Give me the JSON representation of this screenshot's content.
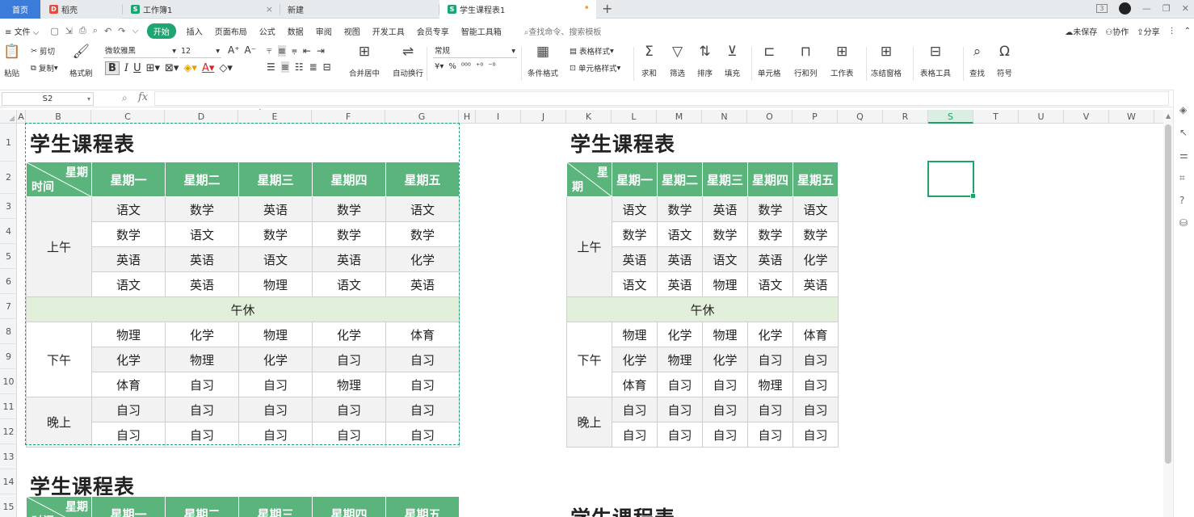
{
  "tabs": {
    "home": "首页",
    "daoke": "稻壳",
    "workbook1": "工作簿1",
    "new": "新建",
    "active": "学生课程表1",
    "new_tab": "+"
  },
  "menu": {
    "file": "文件",
    "items": [
      "开始",
      "插入",
      "页面布局",
      "公式",
      "数据",
      "审阅",
      "视图",
      "开发工具",
      "会员专享",
      "智能工具箱"
    ],
    "search": "查找命令、搜索模板",
    "unsaved": "未保存",
    "collab": "协作",
    "share": "分享"
  },
  "ribbon": {
    "paste": "粘贴",
    "cut": "剪切",
    "copy": "复制",
    "format_painter": "格式刷",
    "font_name": "微软雅黑",
    "font_size": "12",
    "merge_center": "合并居中",
    "auto_wrap": "自动换行",
    "number_format": "常规",
    "table_style": "表格样式",
    "cond_format": "条件格式",
    "cell_style": "单元格样式",
    "sum": "求和",
    "filter": "筛选",
    "sort": "排序",
    "fill": "填充",
    "cell": "单元格",
    "row_col": "行和列",
    "worksheet": "工作表",
    "freeze": "冻结窗格",
    "table_tools": "表格工具",
    "find": "查找",
    "symbol": "符号"
  },
  "formula_bar": {
    "name_box": "S2",
    "fx": "fx",
    "value": ""
  },
  "grid": {
    "columns": [
      "A",
      "B",
      "C",
      "D",
      "E",
      "F",
      "G",
      "H",
      "I",
      "J",
      "K",
      "L",
      "M",
      "N",
      "O",
      "P",
      "Q",
      "R",
      "S",
      "T",
      "U",
      "V",
      "W"
    ],
    "selected_column": "S",
    "rows": [
      "1",
      "2",
      "3",
      "4",
      "5",
      "6",
      "7",
      "8",
      "9",
      "10",
      "11",
      "12",
      "13",
      "14",
      "15"
    ]
  },
  "course_table": {
    "title": "学生课程表",
    "header_week": "星期",
    "header_time": "时间",
    "header_week_short": "星",
    "header_week_short2": "期",
    "header_time_short": "期",
    "days": [
      "星期一",
      "星期二",
      "星期三",
      "星期四",
      "星期五"
    ],
    "morning": "上午",
    "afternoon": "下午",
    "evening": "晚上",
    "noon": "午休",
    "morning_rows": [
      [
        "语文",
        "数学",
        "英语",
        "数学",
        "语文"
      ],
      [
        "数学",
        "语文",
        "数学",
        "数学",
        "数学"
      ],
      [
        "英语",
        "英语",
        "语文",
        "英语",
        "化学"
      ],
      [
        "语文",
        "英语",
        "物理",
        "语文",
        "英语"
      ]
    ],
    "afternoon_rows": [
      [
        "物理",
        "化学",
        "物理",
        "化学",
        "体育"
      ],
      [
        "化学",
        "物理",
        "化学",
        "自习",
        "自习"
      ],
      [
        "体育",
        "自习",
        "自习",
        "物理",
        "自习"
      ]
    ],
    "evening_rows": [
      [
        "自习",
        "自习",
        "自习",
        "自习",
        "自习"
      ],
      [
        "自习",
        "自习",
        "自习",
        "自习",
        "自习"
      ]
    ]
  },
  "colors": {
    "accent": "#1ea672",
    "header_green": "#5ab47c",
    "noon_green": "#e2efda"
  }
}
